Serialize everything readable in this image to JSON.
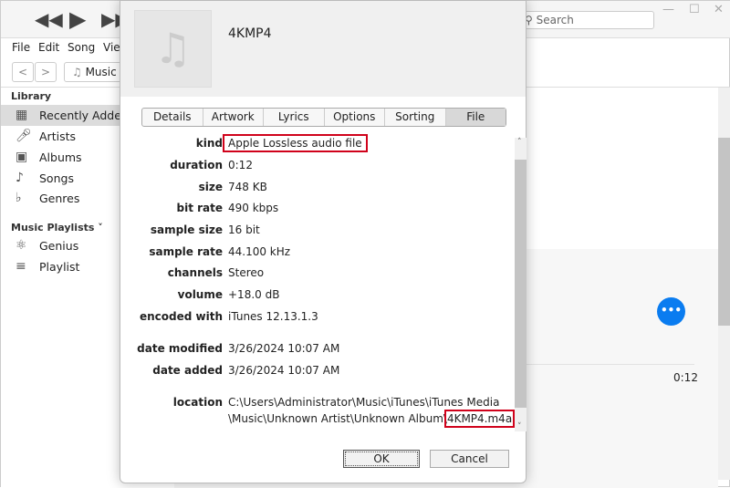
{
  "toolbar": {
    "search_placeholder": "Search",
    "source": "Music"
  },
  "menu": [
    "File",
    "Edit",
    "Song",
    "View"
  ],
  "sidebar": {
    "library_header": "Library",
    "library": [
      "Recently Added",
      "Artists",
      "Albums",
      "Songs",
      "Genres"
    ],
    "playlists_header": "Music Playlists",
    "playlists": [
      "Genius",
      "Playlist"
    ]
  },
  "main": {
    "duration": "0:12"
  },
  "dialog": {
    "title": "4KMP4",
    "tabs": [
      "Details",
      "Artwork",
      "Lyrics",
      "Options",
      "Sorting",
      "File"
    ],
    "selected_tab": "File",
    "fields": [
      {
        "label": "kind",
        "value": "Apple Lossless audio file"
      },
      {
        "label": "duration",
        "value": "0:12"
      },
      {
        "label": "size",
        "value": "748 KB"
      },
      {
        "label": "bit rate",
        "value": "490 kbps"
      },
      {
        "label": "sample size",
        "value": "16 bit"
      },
      {
        "label": "sample rate",
        "value": "44.100 kHz"
      },
      {
        "label": "channels",
        "value": "Stereo"
      },
      {
        "label": "volume",
        "value": "+18.0 dB"
      },
      {
        "label": "encoded with",
        "value": "iTunes 12.13.1.3"
      },
      {
        "label": "date modified",
        "value": "3/26/2024 10:07 AM"
      },
      {
        "label": "date added",
        "value": "3/26/2024 10:07 AM"
      }
    ],
    "location": {
      "label": "location",
      "line1": "C:\\Users\\Administrator\\Music\\iTunes\\iTunes Media",
      "line2": "\\Music\\Unknown Artist\\Unknown Album\\",
      "file": "4KMP4.m4a"
    },
    "ok": "OK",
    "cancel": "Cancel"
  },
  "colors": {
    "highlight": "#d0021b",
    "accent": "#0a7cf0"
  }
}
